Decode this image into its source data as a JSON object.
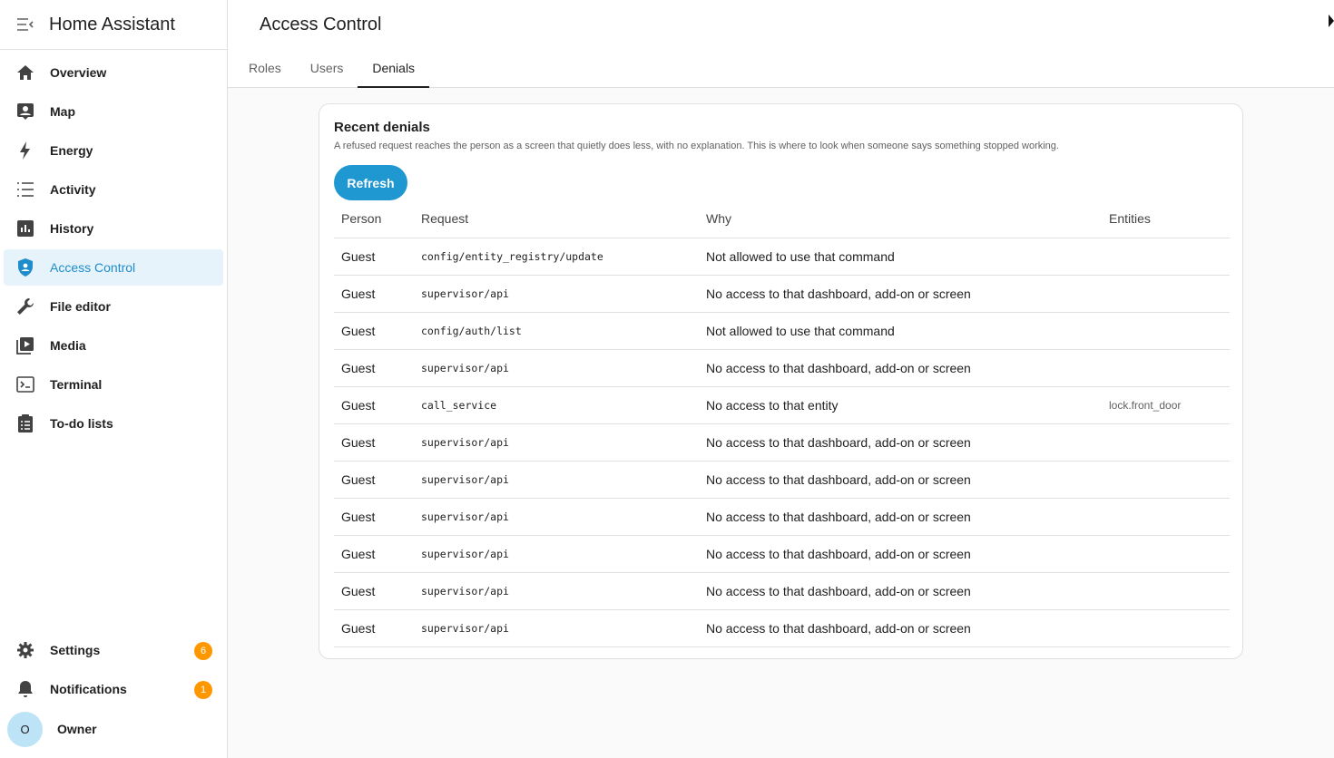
{
  "app": {
    "title": "Home Assistant"
  },
  "sidebar": {
    "items": [
      {
        "label": "Overview",
        "icon": "home-icon"
      },
      {
        "label": "Map",
        "icon": "map-icon"
      },
      {
        "label": "Energy",
        "icon": "energy-icon"
      },
      {
        "label": "Activity",
        "icon": "activity-icon"
      },
      {
        "label": "History",
        "icon": "history-icon"
      },
      {
        "label": "Access Control",
        "icon": "shield-icon",
        "active": true
      },
      {
        "label": "File editor",
        "icon": "wrench-icon"
      },
      {
        "label": "Media",
        "icon": "media-icon"
      },
      {
        "label": "Terminal",
        "icon": "terminal-icon"
      },
      {
        "label": "To-do lists",
        "icon": "clipboard-icon"
      }
    ],
    "settings": {
      "label": "Settings",
      "badge": "6"
    },
    "notifications": {
      "label": "Notifications",
      "badge": "1"
    },
    "user": {
      "initial": "O",
      "name": "Owner"
    }
  },
  "header": {
    "title": "Access Control",
    "tabs": [
      "Roles",
      "Users",
      "Denials"
    ],
    "active_tab": "Denials"
  },
  "card": {
    "title": "Recent denials",
    "description": "A refused request reaches the person as a screen that quietly does less, with no explanation. This is where to look when someone says something stopped working.",
    "refresh_label": "Refresh",
    "columns": [
      "Person",
      "Request",
      "Why",
      "Entities"
    ],
    "rows": [
      [
        "Guest",
        "config/entity_registry/update",
        "Not allowed to use that command",
        ""
      ],
      [
        "Guest",
        "supervisor/api",
        "No access to that dashboard, add-on or screen",
        ""
      ],
      [
        "Guest",
        "config/auth/list",
        "Not allowed to use that command",
        ""
      ],
      [
        "Guest",
        "supervisor/api",
        "No access to that dashboard, add-on or screen",
        ""
      ],
      [
        "Guest",
        "call_service",
        "No access to that entity",
        "lock.front_door"
      ],
      [
        "Guest",
        "supervisor/api",
        "No access to that dashboard, add-on or screen",
        ""
      ],
      [
        "Guest",
        "supervisor/api",
        "No access to that dashboard, add-on or screen",
        ""
      ],
      [
        "Guest",
        "supervisor/api",
        "No access to that dashboard, add-on or screen",
        ""
      ],
      [
        "Guest",
        "supervisor/api",
        "No access to that dashboard, add-on or screen",
        ""
      ],
      [
        "Guest",
        "supervisor/api",
        "No access to that dashboard, add-on or screen",
        ""
      ],
      [
        "Guest",
        "supervisor/api",
        "No access to that dashboard, add-on or screen",
        ""
      ]
    ]
  },
  "colors": {
    "accent": "#1f97d1",
    "active_bg": "#e6f3fb",
    "badge": "#ff9800"
  }
}
